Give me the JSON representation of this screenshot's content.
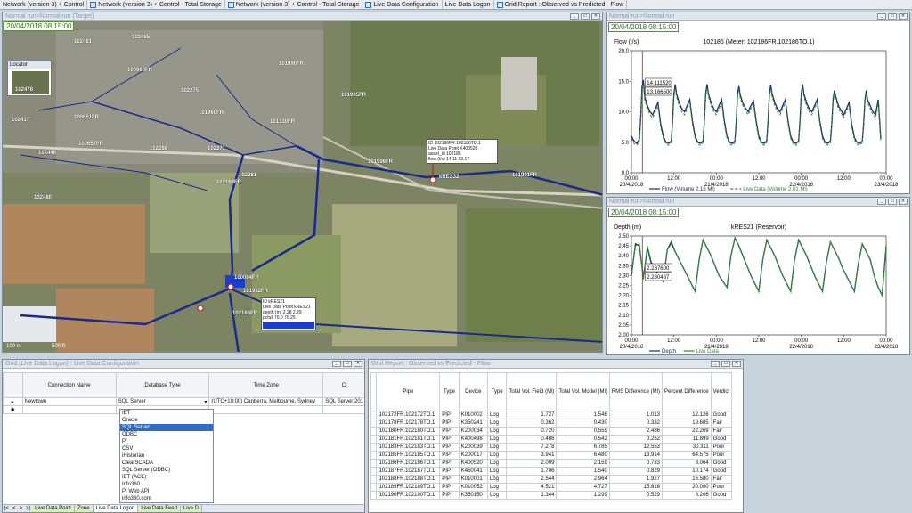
{
  "doc_tabs": [
    "Network (version 3) + Control",
    "Network (version 3) + Control - Total Storage",
    "Network (version 3) + Control - Total Storage",
    "Live Data Configuration",
    "Live Data Logon",
    "Grid Report : Observed vs Predicted - Flow"
  ],
  "map_window": {
    "title": "Normal run>Normal run {Target}",
    "date": "20/04/2018 08:15:00",
    "locator_title": "Locator",
    "labels": [
      "102481",
      "102485",
      "102487",
      "102430",
      "102432",
      "102442",
      "102449",
      "102451",
      "102453",
      "102459",
      "102461",
      "102464",
      "102467",
      "102472",
      "102474",
      "102476",
      "102479",
      "102484",
      "102487FR",
      "102437",
      "102478",
      "102475",
      "102482",
      "102427",
      "102434",
      "100651FR",
      "102480",
      "100657FR",
      "102446",
      "100960FR",
      "101960FR",
      "102286FR",
      "102286",
      "102271",
      "102275",
      "102276",
      "102257",
      "102258",
      "102262",
      "101995FR",
      "101997FR",
      "101330FR",
      "101998FR",
      "100004FR",
      "102169FR",
      "100095FR",
      "101960FR",
      "101994FR",
      "102281",
      "101314FR",
      "102179",
      "102240",
      "102246",
      "102154FR",
      "101959FR",
      "101990FR",
      "kRES21",
      "kRES32",
      "102168FR",
      "101982FR",
      "102192FR",
      "101991FR"
    ],
    "tooltip1": [
      "ID  102186FR.102186TO.1",
      "Live Data Point  K400520",
      "asset_id  102186",
      "flow (l/s)  14.11  13.17"
    ],
    "tooltip2": [
      "ID  kRES21",
      "Live Data Point  kRES21",
      "depth (m)  2.28  2.29",
      "pcfull  76.0  76.25"
    ],
    "scale_left": "100 m",
    "scale_right": "500 ft"
  },
  "flow_chart_window": {
    "title": "Normal run>Normal run",
    "date": "20/04/2018 08:15:00"
  },
  "depth_chart_window": {
    "title": "Normal run>Normal run",
    "date": "20/04/2018 08:15:00"
  },
  "chart_data": [
    {
      "type": "line",
      "title": "102186 (Meter: 102186FR.102186TO.1)",
      "ylabel": "Flow (l/s)",
      "ylim": [
        0,
        20
      ],
      "yticks": [
        "0.0",
        "5.0",
        "10.0",
        "15.0",
        "20.0"
      ],
      "xticks": [
        [
          "00:00",
          "20/4/2018"
        ],
        [
          "12:00",
          ""
        ],
        [
          "00:00",
          "21/4/2018"
        ],
        [
          "12:00",
          ""
        ],
        [
          "00:00",
          "22/4/2018"
        ],
        [
          "12:00",
          ""
        ],
        [
          "00:00",
          "23/4/2018"
        ]
      ],
      "marker_x": 8.25,
      "annotations": [
        "14.111520",
        "13.166500"
      ],
      "legend": [
        "Flow (Volume 2.16 Ml)",
        "Live Data (Volume 2.01 Ml)"
      ],
      "x_hours": [
        0,
        2,
        4,
        6,
        7,
        8,
        9,
        10,
        12,
        14,
        16,
        18,
        20,
        22,
        24,
        26,
        28,
        30,
        31,
        32,
        33,
        34,
        36,
        38,
        40,
        42,
        44,
        46,
        48,
        50,
        52,
        54,
        55,
        56,
        57,
        58,
        60,
        62,
        64,
        66,
        68,
        70,
        72,
        74,
        76,
        78,
        79,
        80,
        81,
        82,
        84,
        86,
        88,
        90,
        92,
        94,
        96,
        98,
        100,
        102,
        103,
        104,
        105,
        106,
        108,
        110,
        112,
        114,
        116,
        118,
        120,
        122,
        124,
        126,
        127,
        128,
        129,
        130,
        132,
        134,
        136,
        138,
        140,
        142,
        144,
        146,
        148,
        150,
        151,
        152,
        153,
        154,
        156,
        158,
        160,
        162,
        164,
        166,
        168,
        170,
        172,
        174,
        175,
        176,
        177,
        178,
        180,
        182,
        184,
        186,
        188,
        190,
        192
      ],
      "series": [
        {
          "name": "Flow",
          "color": "#1f2a6b",
          "dash": false,
          "values": [
            6,
            5.2,
            4.8,
            5.5,
            9,
            14.1,
            15.2,
            12.5,
            11,
            10,
            9.5,
            10.5,
            11.5,
            8,
            6,
            5,
            4.8,
            5.2,
            8.5,
            13,
            14.5,
            13,
            11.5,
            10.5,
            10,
            11,
            12,
            8.5,
            6,
            5,
            4.8,
            5.2,
            8.5,
            13,
            14.5,
            13,
            11.5,
            10.5,
            10,
            11,
            12,
            8.5,
            6,
            5,
            4.8,
            5.2,
            8.5,
            13,
            14.2,
            12.8,
            11.4,
            10.6,
            10,
            11,
            11.8,
            8.5,
            6,
            5,
            4.8,
            5.2,
            8.5,
            13,
            14.4,
            13,
            11.5,
            10.5,
            10,
            11,
            12,
            8.5,
            6,
            5,
            4.8,
            5.2,
            8.5,
            13,
            14.5,
            13,
            11.5,
            10.5,
            10,
            11,
            12,
            8.5,
            6,
            5,
            4.8,
            5.2,
            8,
            12,
            13.5,
            12.5,
            11,
            10.2,
            9.5,
            10.5,
            11.5,
            8,
            5.8,
            5,
            4.8,
            5.2,
            8,
            12,
            13.5,
            12,
            11,
            10,
            9.5,
            12,
            5.5
          ]
        },
        {
          "name": "Live Data",
          "color": "#2e8b2e",
          "dash": true,
          "values": [
            5.6,
            4.8,
            4.5,
            5.1,
            8.5,
            13.2,
            14.5,
            12,
            10.5,
            9.5,
            9,
            10,
            11,
            7.5,
            5.6,
            4.7,
            4.5,
            4.9,
            8,
            12.5,
            14,
            12.5,
            11,
            10,
            9.5,
            10.5,
            11.5,
            8,
            5.6,
            4.7,
            4.5,
            4.9,
            8,
            12.5,
            14,
            12.5,
            11,
            10,
            9.5,
            10.5,
            11.5,
            8,
            5.6,
            4.7,
            4.5,
            4.9,
            8,
            12.5,
            13.7,
            12.3,
            11,
            10.1,
            9.5,
            10.5,
            11.3,
            8,
            5.6,
            4.7,
            4.5,
            4.9,
            8,
            12.5,
            13.9,
            12.5,
            11,
            10,
            9.5,
            10.5,
            11.5,
            8,
            5.6,
            4.7,
            4.5,
            4.9,
            8,
            12.5,
            14,
            12.5,
            11,
            10,
            9.5,
            10.5,
            11.5,
            8,
            5.6,
            4.7,
            4.5,
            4.9,
            7.6,
            11.5,
            13,
            12,
            10.5,
            9.8,
            9,
            10,
            11,
            7.5,
            5.4,
            4.7,
            4.5,
            4.9,
            7.6,
            11.5,
            13,
            11.5,
            10.5,
            9.5,
            9,
            11.5,
            5.2
          ]
        }
      ]
    },
    {
      "type": "line",
      "title": "kRES21 (Reservoir)",
      "ylabel": "Depth (m)",
      "ylim": [
        2.0,
        2.5
      ],
      "yticks": [
        "2.00",
        "2.05",
        "2.10",
        "2.15",
        "2.20",
        "2.25",
        "2.30",
        "2.35",
        "2.40",
        "2.45",
        "2.50"
      ],
      "xticks": [
        [
          "00:00",
          "20/4/2018"
        ],
        [
          "12:00",
          ""
        ],
        [
          "00:00",
          "21/4/2018"
        ],
        [
          "12:00",
          ""
        ],
        [
          "00:00",
          "22/4/2018"
        ],
        [
          "12:00",
          ""
        ],
        [
          "00:00",
          "23/4/2018"
        ]
      ],
      "marker_x": 8.25,
      "annotations": [
        "2.287600",
        "2.280487"
      ],
      "legend": [
        "Depth",
        "Live Data"
      ],
      "x_hours": [
        0,
        3,
        6,
        9,
        12,
        15,
        18,
        21,
        24,
        27,
        30,
        33,
        36,
        39,
        42,
        45,
        48,
        51,
        54,
        57,
        60,
        63,
        66,
        69,
        72,
        75,
        78,
        81,
        84,
        87,
        90,
        93,
        96,
        99,
        102,
        105,
        108,
        111,
        114,
        117,
        120,
        123,
        126,
        129,
        132,
        135,
        138,
        141,
        144,
        147,
        150,
        153,
        156,
        159,
        162,
        165,
        168,
        171,
        174,
        177,
        180,
        183,
        186,
        189,
        192
      ],
      "series": [
        {
          "name": "Depth",
          "color": "#1f2a6b",
          "dash": false,
          "values": [
            2.3,
            2.46,
            2.45,
            2.29,
            2.44,
            2.36,
            2.33,
            2.3,
            2.27,
            2.43,
            2.47,
            2.42,
            2.38,
            2.34,
            2.3,
            2.26,
            2.22,
            2.38,
            2.48,
            2.44,
            2.4,
            2.35,
            2.3,
            2.27,
            2.24,
            2.4,
            2.49,
            2.45,
            2.4,
            2.35,
            2.3,
            2.26,
            2.22,
            2.38,
            2.48,
            2.44,
            2.4,
            2.35,
            2.3,
            2.26,
            2.22,
            2.38,
            2.48,
            2.44,
            2.4,
            2.35,
            2.3,
            2.26,
            2.22,
            2.37,
            2.47,
            2.43,
            2.39,
            2.34,
            2.3,
            2.26,
            2.22,
            2.36,
            2.46,
            2.42,
            2.38,
            2.3,
            2.24,
            2.2,
            2.45
          ]
        },
        {
          "name": "Live Data",
          "color": "#2e8b2e",
          "dash": false,
          "values": [
            2.31,
            2.45,
            2.46,
            2.28,
            2.45,
            2.37,
            2.33,
            2.29,
            2.28,
            2.43,
            2.46,
            2.42,
            2.38,
            2.34,
            2.3,
            2.26,
            2.22,
            2.38,
            2.48,
            2.44,
            2.4,
            2.35,
            2.3,
            2.27,
            2.24,
            2.4,
            2.49,
            2.45,
            2.4,
            2.35,
            2.3,
            2.26,
            2.22,
            2.38,
            2.48,
            2.44,
            2.4,
            2.35,
            2.3,
            2.26,
            2.22,
            2.38,
            2.48,
            2.44,
            2.4,
            2.35,
            2.3,
            2.26,
            2.22,
            2.37,
            2.47,
            2.43,
            2.39,
            2.34,
            2.3,
            2.26,
            2.22,
            2.36,
            2.46,
            2.42,
            2.38,
            2.3,
            2.24,
            2.2,
            2.45
          ]
        }
      ]
    }
  ],
  "ldc_window": {
    "title": "Grid (Live Data Logon) - Live Data Configuration",
    "columns": [
      "Connection Name",
      "Database Type",
      "Time Zone",
      "Cl"
    ],
    "row": {
      "connection": "Newtown",
      "db_type": "SQL Server",
      "timezone": "(UTC+10:00) Canberra, Melbourne, Sydney",
      "cl": "SQL Server 201"
    },
    "dropdown_options": [
      "IET",
      "Oracle",
      "SQL Server",
      "ODBC",
      "PI",
      "CSV",
      "iHistorian",
      "ClearSCADA",
      "SQL Server (ODBC)",
      "IET (ACE)",
      "Info360",
      "PI Web API",
      "info360.com"
    ],
    "dropdown_selected": "SQL Server",
    "bottom_tabs": [
      "Live Data Point",
      "Zone",
      "Live Data Logon",
      "Live Data Feed",
      "Live D"
    ],
    "active_tab": "Live Data Logon"
  },
  "report_window": {
    "title": "Grid Report : Observed vs Predicted - Flow",
    "columns": [
      "Pipe",
      "Type",
      "Device",
      "Type",
      "Total Vol. Field (Ml)",
      "Total Vol. Model (Ml)",
      "RMS Difference (Ml)",
      "Percent Difference",
      "Verdict"
    ],
    "rows": [
      [
        "102172FR.102172TO.1",
        "PIP",
        "K010002",
        "Log",
        "1.727",
        "1.546",
        "1.013",
        "12.126",
        "Good"
      ],
      [
        "102178FR.102178TO.1",
        "PIP",
        "K350241",
        "Log",
        "0.362",
        "0.430",
        "0.332",
        "19.685",
        "Fair"
      ],
      [
        "102180FR.102180TO.1",
        "PIP",
        "K200034",
        "Log",
        "0.720",
        "0.559",
        "2.486",
        "22.269",
        "Fair"
      ],
      [
        "102181FR.102181TO.1",
        "PIP",
        "K400498",
        "Log",
        "0.486",
        "0.542",
        "0.262",
        "11.899",
        "Good"
      ],
      [
        "102183FR.102183TO.1",
        "PIP",
        "K200039",
        "Log",
        "7.278",
        "6.785",
        "12.553",
        "30.311",
        "Poor"
      ],
      [
        "102185FR.102185TO.1",
        "PIP",
        "K200017",
        "Log",
        "3.941",
        "6.480",
        "13.914",
        "64.575",
        "Poor"
      ],
      [
        "102186FR.102186TO.1",
        "PIP",
        "K400520",
        "Log",
        "2.009",
        "2.159",
        "0.733",
        "8.064",
        "Good"
      ],
      [
        "102187FR.102187TO.1",
        "PIP",
        "K450041",
        "Log",
        "1.706",
        "1.540",
        "0.829",
        "10.174",
        "Good"
      ],
      [
        "102188FR.102188TO.1",
        "PIP",
        "K010001",
        "Log",
        "2.544",
        "2.964",
        "1.927",
        "16.580",
        "Fair"
      ],
      [
        "102189FR.102189TO.1",
        "PIP",
        "K010052",
        "Log",
        "4.521",
        "4.727",
        "15.616",
        "20.000",
        "Poor"
      ],
      [
        "102190FR.102190TO.1",
        "PIP",
        "K350150",
        "Log",
        "1.344",
        "1.299",
        "0.529",
        "8.206",
        "Good"
      ]
    ]
  }
}
